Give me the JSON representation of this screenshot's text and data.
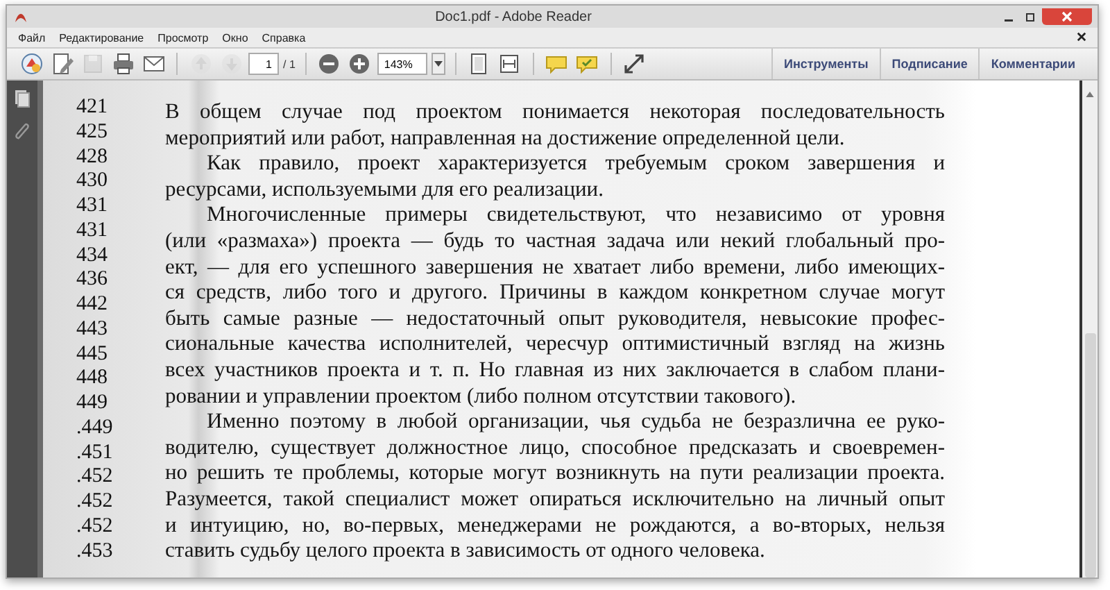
{
  "window": {
    "title": "Doc1.pdf - Adobe Reader"
  },
  "menu": [
    "Файл",
    "Редактирование",
    "Просмотр",
    "Окно",
    "Справка"
  ],
  "toolbar": [
    {
      "kind": "create",
      "disabled": false
    },
    {
      "kind": "edit",
      "disabled": false
    },
    {
      "kind": "save",
      "disabled": true
    },
    {
      "kind": "print",
      "disabled": false
    },
    {
      "kind": "email",
      "disabled": false
    },
    {
      "kind": "separator"
    },
    {
      "kind": "up",
      "disabled": true
    },
    {
      "kind": "down",
      "disabled": true
    },
    {
      "kind": "page",
      "value": "1"
    },
    {
      "kind": "label",
      "text": "/ 1"
    },
    {
      "kind": "separator"
    },
    {
      "kind": "zoom-out",
      "disabled": false
    },
    {
      "kind": "zoom-in",
      "disabled": false
    },
    {
      "kind": "zoom",
      "value": "143%"
    },
    {
      "kind": "separator"
    },
    {
      "kind": "fit-page",
      "disabled": false
    },
    {
      "kind": "fit-width",
      "disabled": false
    },
    {
      "kind": "separator"
    },
    {
      "kind": "comment",
      "disabled": false
    },
    {
      "kind": "highlight",
      "disabled": false
    },
    {
      "kind": "separator"
    },
    {
      "kind": "expand",
      "disabled": false
    }
  ],
  "panel_tabs": [
    "Инструменты",
    "Подписание",
    "Комментарии"
  ],
  "document": {
    "line_numbers": [
      "421",
      "425",
      "428",
      "430",
      "431",
      "431",
      "434",
      "436",
      "442",
      "443",
      "445",
      "448",
      "449",
      ".449",
      ".451",
      ".452",
      ".452",
      ".452",
      ".453"
    ],
    "paragraphs": [
      {
        "indent": false,
        "lines": [
          "В общем случае под проектом понимается некоторая последовательность",
          "мероприятий или работ, направленная на достижение определенной цели."
        ]
      },
      {
        "indent": true,
        "lines": [
          "Как правило, проект характеризуется требуемым сроком завершения и",
          "ресурсами, используемыми для его реализации."
        ]
      },
      {
        "indent": true,
        "lines": [
          "Многочисленные примеры свидетельствуют, что независимо от уровня",
          "(или «размаха») проекта — будь то частная задача или некий глобальный про-",
          "ект, — для его успешного завершения не хватает либо времени, либо имеющих-",
          "ся средств, либо того и другого. Причины в каждом конкретном случае могут",
          "быть самые разные — недостаточный опыт руководителя, невысокие профес-",
          "сиональные качества исполнителей, чересчур оптимистичный взгляд на жизнь",
          "всех участников проекта и т. п. Но главная из них заключается в слабом плани-",
          "ровании и управлении проектом (либо полном отсутствии такового)."
        ]
      },
      {
        "indent": true,
        "lines": [
          "Именно поэтому в любой организации, чья судьба не безразлична ее руко-",
          "водителю, существует должностное лицо, способное предсказать и своевремен-",
          "но решить те проблемы, которые могут возникнуть на пути реализации проекта.",
          "Разумеется, такой специалист может опираться исключительно на личный опыт",
          "и интуицию, но, во-первых, менеджерами не рождаются, а во-вторых, нельзя",
          "ставить судьбу целого проекта в зависимость от одного человека."
        ]
      }
    ]
  }
}
